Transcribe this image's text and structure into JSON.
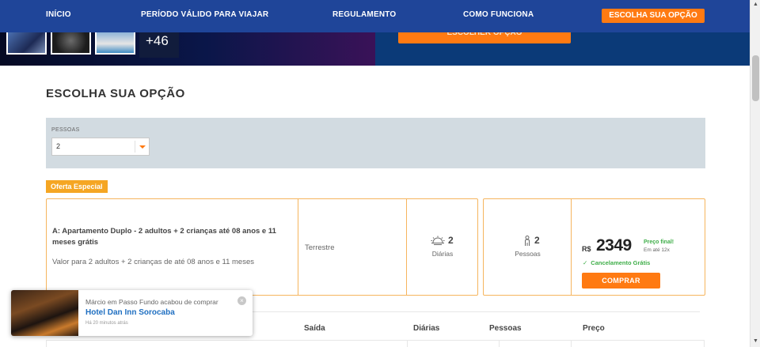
{
  "nav": {
    "items": [
      "INÍCIO",
      "PERÍODO VÁLIDO PARA VIAJAR",
      "REGULAMENTO",
      "COMO FUNCIONA"
    ],
    "cta": "ESCOLHA SUA OPÇÃO"
  },
  "hero": {
    "more_photos": "+46",
    "button_label": "ESCOLHER OPÇÃO"
  },
  "section_title": "ESCOLHA SUA OPÇÃO",
  "filter": {
    "label": "PESSOAS",
    "value": "2"
  },
  "badge": "Oferta Especial",
  "offer": {
    "title": "A: Apartamento Duplo - 2 adultos + 2 crianças até 08 anos e 11 meses grátis",
    "subtitle": "Valor para 2 adultos + 2 crianças de até 08 anos e 11 meses",
    "type": "Terrestre",
    "days_count": "2",
    "days_label": "Diárias",
    "people_count": "2",
    "people_label": "Pessoas",
    "currency": "R$",
    "price": "2349",
    "price_final": "Preço final!",
    "installments": "Em até 12x",
    "cancellation": "Cancelamento Grátis",
    "buy_label": "COMPRAR"
  },
  "table_headers": {
    "exit": "Saída",
    "days": "Diárias",
    "people": "Pessoas",
    "price": "Preço"
  },
  "toast": {
    "message": "Márcio em Passo Fundo acabou de comprar",
    "hotel": "Hotel Dan Inn Sorocaba",
    "time": "Há 20 minutos atrás",
    "close": "×"
  },
  "colors": {
    "nav_bg": "#1f4599",
    "accent": "#ff7a12",
    "badge": "#f5a623",
    "success": "#3fae49",
    "link": "#1f6fc1"
  }
}
